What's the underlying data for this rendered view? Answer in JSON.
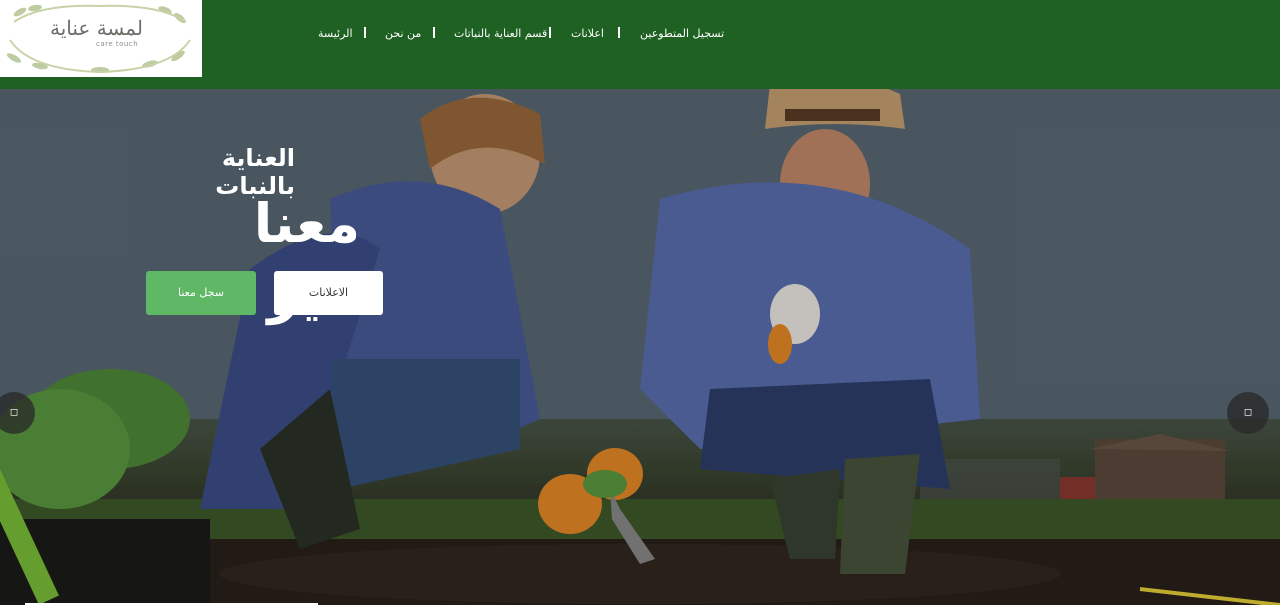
{
  "header": {
    "logo": {
      "text": "لمسة عناية",
      "subtext": "care touch"
    },
    "nav": [
      {
        "label": "تسجيل المتطوعين"
      },
      {
        "label": "اعلانات"
      },
      {
        "label": "قسم العناية بالنباتات"
      },
      {
        "label": "من نحن"
      },
      {
        "label": "الرئيسة"
      }
    ]
  },
  "hero": {
    "subtitle": "العناية بالنبات",
    "title": "معنا غير",
    "buttons": {
      "register": "سجل معنا",
      "ads": "الاعلانات"
    },
    "arrows": {
      "prev": "◻",
      "next": "◻"
    },
    "slide_progress": 0.23
  },
  "colors": {
    "header_bg": "#1f6122",
    "register_button": "#5fb866",
    "ads_button": "#ffffff"
  }
}
